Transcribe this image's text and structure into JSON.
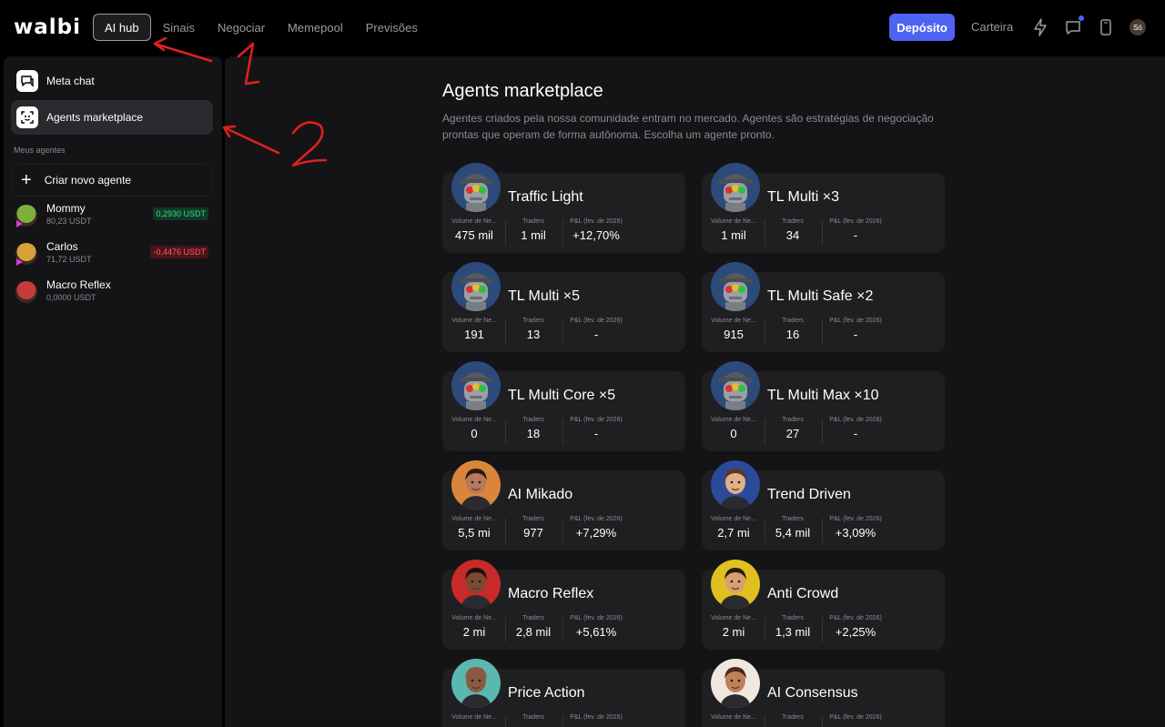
{
  "app": {
    "logo": "walbi"
  },
  "nav": {
    "items": [
      {
        "label": "AI hub",
        "active": true
      },
      {
        "label": "Sinais"
      },
      {
        "label": "Negociar"
      },
      {
        "label": "Memepool"
      },
      {
        "label": "Previsões"
      }
    ],
    "deposit_label": "Depósito",
    "wallet_label": "Carteira",
    "user_initials": "Só",
    "icons": [
      "lightning-icon",
      "chat-icon",
      "phone-icon"
    ]
  },
  "sidebar": {
    "items": [
      {
        "label": "Meta chat",
        "icon": "chat-bubble-icon"
      },
      {
        "label": "Agents marketplace",
        "icon": "robot-face-icon",
        "active": true
      }
    ],
    "section_label": "Meus agentes",
    "create_label": "Criar novo agente",
    "agents": [
      {
        "name": "Mommy",
        "balance": "80,23 USDT",
        "pnl": "0,2930 USDT",
        "pnl_sign": "pos",
        "avatar_color": "#7fae3a"
      },
      {
        "name": "Carlos",
        "balance": "71,72 USDT",
        "pnl": "-0,4476 USDT",
        "pnl_sign": "neg",
        "avatar_color": "#d8a23a"
      },
      {
        "name": "Macro Reflex",
        "balance": "0,0000 USDT",
        "pnl": "",
        "pnl_sign": "",
        "avatar_color": "#c83a3a"
      }
    ]
  },
  "main": {
    "title": "Agents marketplace",
    "description": "Agentes criados pela nossa comunidade entram no mercado. Agentes são estratégias de negociação prontas que operam de forma autônoma. Escolha um agente pronto.",
    "stat_labels": {
      "volume": "Volume de Ne...",
      "traders": "Traders",
      "pnl": "P&L (fev. de 2026)"
    },
    "cards": [
      {
        "title": "Traffic Light",
        "volume": "475 mil",
        "traders": "1 mil",
        "pnl": "+12,70%",
        "avatar": "robot",
        "bg": "#2c4a7a"
      },
      {
        "title": "TL Multi ×3",
        "volume": "1 mil",
        "traders": "34",
        "pnl": "-",
        "avatar": "robot",
        "bg": "#2c4a7a"
      },
      {
        "title": "TL Multi ×5",
        "volume": "191",
        "traders": "13",
        "pnl": "-",
        "avatar": "robot",
        "bg": "#2c4a7a"
      },
      {
        "title": "TL Multi Safe ×2",
        "volume": "915",
        "traders": "16",
        "pnl": "-",
        "avatar": "robot",
        "bg": "#2c4a7a"
      },
      {
        "title": "TL Multi Core ×5",
        "volume": "0",
        "traders": "18",
        "pnl": "-",
        "avatar": "robot",
        "bg": "#2c4a7a"
      },
      {
        "title": "TL Multi Max ×10",
        "volume": "0",
        "traders": "27",
        "pnl": "-",
        "avatar": "robot",
        "bg": "#2c4a7a"
      },
      {
        "title": "AI Mikado",
        "volume": "5,5 mi",
        "traders": "977",
        "pnl": "+7,29%",
        "avatar": "person",
        "bg": "#d9853a",
        "skin": "#b8785a",
        "hair": "#2a1a14"
      },
      {
        "title": "Trend Driven",
        "volume": "2,7 mi",
        "traders": "5,4 mil",
        "pnl": "+3,09%",
        "avatar": "person",
        "bg": "#2c4a9a",
        "skin": "#e0b08a",
        "hair": "#5a3820"
      },
      {
        "title": "Macro Reflex",
        "volume": "2 mi",
        "traders": "2,8 mil",
        "pnl": "+5,61%",
        "avatar": "person",
        "bg": "#c82a2a",
        "skin": "#7a4a30",
        "hair": "#1a1010"
      },
      {
        "title": "Anti Crowd",
        "volume": "2 mi",
        "traders": "1,3 mil",
        "pnl": "+2,25%",
        "avatar": "person",
        "bg": "#e0c020",
        "skin": "#d8a070",
        "hair": "#2a1a10"
      },
      {
        "title": "Price Action",
        "volume": "",
        "traders": "",
        "pnl": "",
        "avatar": "person",
        "bg": "#5ab8b0",
        "skin": "#8a5a40",
        "hair": "#8a5a40"
      },
      {
        "title": "AI Consensus",
        "volume": "",
        "traders": "",
        "pnl": "",
        "avatar": "person",
        "bg": "#f0e8e0",
        "skin": "#c0805a",
        "hair": "#4a2a1a"
      }
    ]
  },
  "annotations": {
    "marker_1": "1",
    "marker_2": "2",
    "color": "#e02020"
  }
}
